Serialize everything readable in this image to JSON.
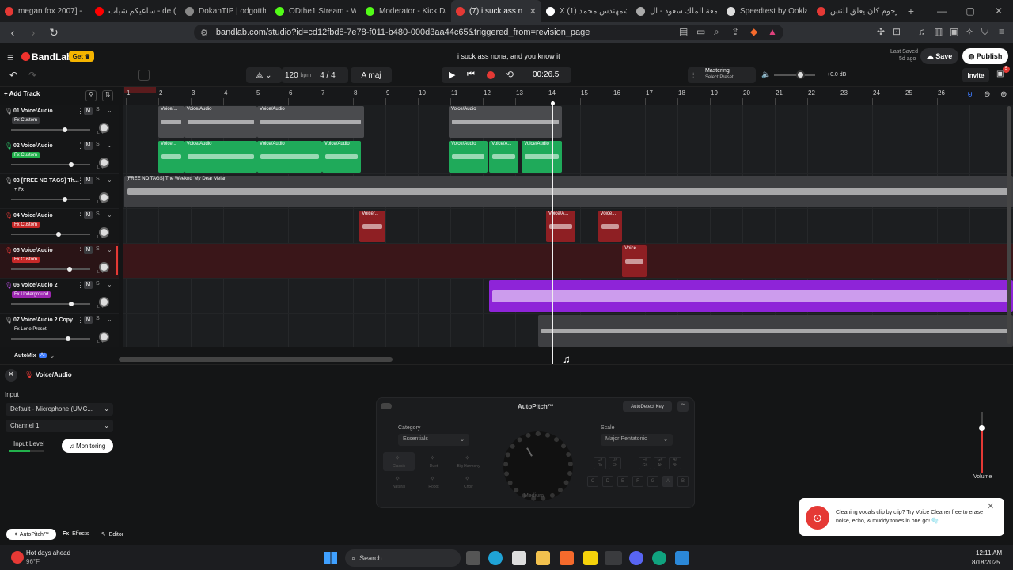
{
  "browser": {
    "tabs": [
      {
        "title": "megan fox 2007] - Bra",
        "icon": "c"
      },
      {
        "title": "ساعيكم شباب - de (87)",
        "icon": "y"
      },
      {
        "title": "DokanTIP | odgotthatd",
        "icon": "d"
      },
      {
        "title": "ODthe1 Stream - Watc",
        "icon": "k"
      },
      {
        "title": "Moderator - Kick Dash",
        "icon": "k"
      },
      {
        "title": "(7) i suck ass n",
        "icon": "b"
      },
      {
        "title": "X باشمهندس محمد (1)",
        "icon": "x"
      },
      {
        "title": "جامعة الملك سعود - ال",
        "icon": "g"
      },
      {
        "title": "Speedtest by Ookla -",
        "icon": "s"
      },
      {
        "title": "المرحوم كان يعلق للنس",
        "icon": "c"
      }
    ],
    "new_tab": "+",
    "url": "bandlab.com/studio?id=cd12fbd8-7e78-f011-b480-000d3aa44c65&triggered_from=revision_page"
  },
  "header": {
    "logo": "BandLab",
    "get_label": "Get",
    "song_title": "i suck ass nona, and you know it",
    "last_saved_label": "Last Saved",
    "last_saved_value": "5d ago",
    "save_label": "Save",
    "publish_label": "Publish",
    "bpm_value": "120",
    "bpm_unit": "bpm",
    "time_sig": "4 / 4",
    "key": "A maj",
    "time": "00:26.5",
    "mastering_title": "Mastering",
    "mastering_sub": "Select Preset",
    "volume_db": "+0.0 dB",
    "invite_label": "Invite",
    "add_track_label": "Add Track",
    "notif_count": "5"
  },
  "ruler": [
    "1",
    "2",
    "3",
    "4",
    "5",
    "6",
    "7",
    "8",
    "9",
    "10",
    "11",
    "12",
    "13",
    "14",
    "15",
    "16",
    "17",
    "18",
    "19",
    "20",
    "21",
    "22",
    "23",
    "24",
    "25",
    "26"
  ],
  "tracks": [
    {
      "num": "01",
      "name": "Voice/Audio",
      "fx": "Fx Custom",
      "fx_color": "#3a3b3e",
      "mic_color": "#aaa",
      "vol": 0.68,
      "clips": [
        {
          "label": "Voice/...",
          "start": 1.0,
          "len": 0.8,
          "color": "#4a4b4e"
        },
        {
          "label": "Voice/Audio",
          "start": 1.8,
          "len": 2.25,
          "color": "#4a4b4e"
        },
        {
          "label": "Voice/Audio",
          "start": 4.05,
          "len": 3.3,
          "color": "#4a4b4e"
        },
        {
          "label": "Voice/Audio",
          "start": 9.95,
          "len": 3.5,
          "color": "#4a4b4e"
        }
      ]
    },
    {
      "num": "02",
      "name": "Voice/Audio",
      "fx": "Fx Custom",
      "fx_color": "#22b14c",
      "mic_color": "#2ec46b",
      "vol": 0.76,
      "clips": [
        {
          "label": "Voice...",
          "start": 1.0,
          "len": 0.8,
          "color": "#1faa5a"
        },
        {
          "label": "Voice/Audio",
          "start": 1.8,
          "len": 2.25,
          "color": "#1faa5a"
        },
        {
          "label": "Voice/Audio",
          "start": 4.05,
          "len": 2.0,
          "color": "#1faa5a"
        },
        {
          "label": "Voice/Audio",
          "start": 6.05,
          "len": 1.2,
          "color": "#1faa5a"
        },
        {
          "label": "Voice/Audio",
          "start": 9.95,
          "len": 1.2,
          "color": "#1faa5a"
        },
        {
          "label": "Voice/A...",
          "start": 11.2,
          "len": 0.9,
          "color": "#1faa5a"
        },
        {
          "label": "Voice/Audio",
          "start": 12.2,
          "len": 1.25,
          "color": "#1faa5a"
        }
      ]
    },
    {
      "num": "03",
      "name": "[FREE NO TAGS] Th...",
      "fx": "+ Fx",
      "fx_color": "transparent",
      "mic_color": "#aaa",
      "vol": 0.68,
      "clips": [
        {
          "label": "[FREE NO TAGS] The Weeknd 'My Dear Melan",
          "start": -0.05,
          "len": 27.6,
          "color": "#3e3f42"
        }
      ]
    },
    {
      "num": "04",
      "name": "Voice/Audio",
      "fx": "Fx Custom",
      "fx_color": "#c62828",
      "mic_color": "#e53935",
      "vol": 0.6,
      "clips": [
        {
          "label": "Voice/...",
          "start": 7.2,
          "len": 0.8,
          "color": "#8e1f23"
        },
        {
          "label": "Voice/A...",
          "start": 12.95,
          "len": 0.9,
          "color": "#8e1f23"
        },
        {
          "label": "Voice...",
          "start": 14.55,
          "len": 0.75,
          "color": "#8e1f23"
        }
      ]
    },
    {
      "num": "05",
      "name": "Voice/Audio",
      "fx": "Fx Custom",
      "fx_color": "#c62828",
      "mic_color": "#e53935",
      "vol": 0.74,
      "clips": [
        {
          "label": "Voice...",
          "start": 15.3,
          "len": 0.75,
          "color": "#8e1f23"
        }
      ]
    },
    {
      "num": "06",
      "name": "Voice/Audio 2",
      "fx": "Fx Underground",
      "fx_color": "#9c27b0",
      "mic_color": "#b44de0",
      "vol": 0.76,
      "clips": [
        {
          "label": "",
          "start": 11.2,
          "len": 16.5,
          "color": "#8e24d8"
        }
      ]
    },
    {
      "num": "07",
      "name": "Voice/Audio 2 Copy",
      "fx": "Fx Lone Preset",
      "fx_color": "transparent",
      "mic_color": "#aaa",
      "vol": 0.72,
      "clips": [
        {
          "label": "",
          "start": 12.7,
          "len": 15.0,
          "color": "#3e3f42"
        }
      ]
    }
  ],
  "bottom": {
    "automix_label": "AutoMix",
    "ai_badge": "AI",
    "track_name": "Voice/Audio",
    "input_label": "Input",
    "input_device": "Default - Microphone (UMC...",
    "channel": "Channel 1",
    "input_level_label": "Input Level",
    "monitoring_label": "Monitoring",
    "plugin_title": "AutoPitch™",
    "autodetect_label": "AutoDetect Key",
    "category_label": "Category",
    "category_value": "Essentials",
    "scale_label": "Scale",
    "scale_value": "Major Pentatonic",
    "knob_label": "Medium",
    "presets": [
      "Classic",
      "Duet",
      "Big Harmony",
      "Natural",
      "Robot",
      "Choir"
    ],
    "notes_sharp": [
      "C#\nDb",
      "D#\nEb",
      "F#\nGb",
      "G#\nAb",
      "A#\nBb"
    ],
    "notes": [
      "C",
      "D",
      "E",
      "F",
      "G",
      "A",
      "B"
    ],
    "volume_label": "Volume",
    "tab_autopitch": "AutoPitch™",
    "tab_effects": "Effects",
    "tab_editor": "Editor",
    "fx_prefix": "Fx"
  },
  "toast": {
    "text": "Cleaning vocals clip by clip? Try Voice Cleaner free to erase noise, echo, & muddy tones in one go! 🫧"
  },
  "taskbar": {
    "weather_title": "Hot days ahead",
    "weather_temp": "96°F",
    "search": "Search",
    "time": "12:11 AM",
    "date": "8/18/2025"
  }
}
